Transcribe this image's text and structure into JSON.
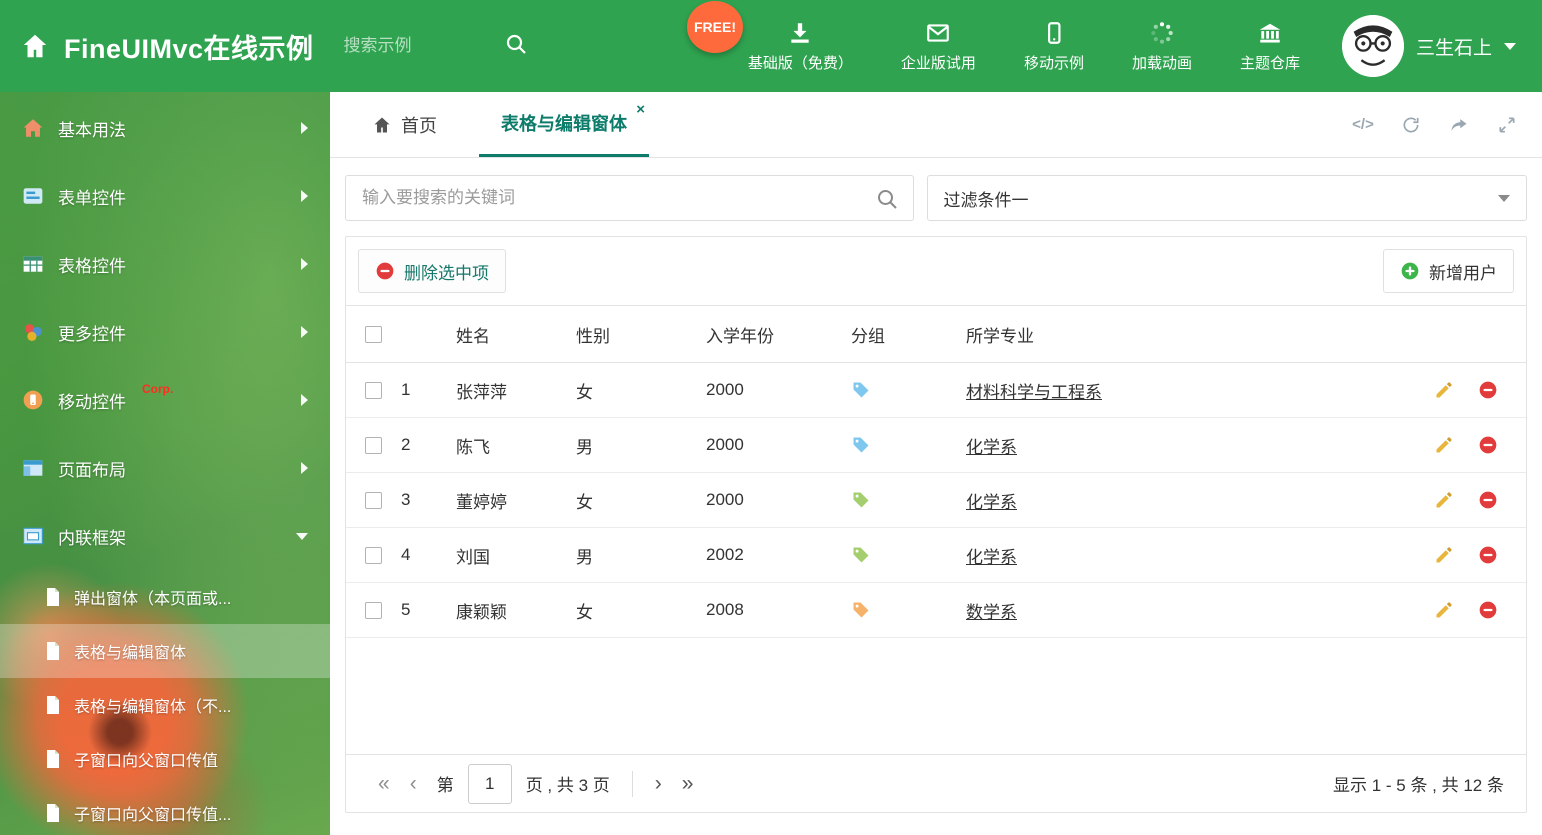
{
  "header": {
    "title": "FineUIMvc在线示例",
    "search_placeholder": "搜索示例",
    "free_badge": "FREE!",
    "nav": [
      {
        "label": "基础版（免费）"
      },
      {
        "label": "企业版试用"
      },
      {
        "label": "移动示例"
      },
      {
        "label": "加载动画"
      },
      {
        "label": "主题仓库"
      }
    ],
    "user_name": "三生石上"
  },
  "sidebar": {
    "items": [
      {
        "label": "基本用法"
      },
      {
        "label": "表单控件"
      },
      {
        "label": "表格控件"
      },
      {
        "label": "更多控件"
      },
      {
        "label": "移动控件",
        "badge": "Corp."
      },
      {
        "label": "页面布局"
      },
      {
        "label": "内联框架"
      }
    ],
    "submenu": [
      {
        "label": "弹出窗体（本页面或..."
      },
      {
        "label": "表格与编辑窗体"
      },
      {
        "label": "表格与编辑窗体（不..."
      },
      {
        "label": "子窗口向父窗口传值"
      },
      {
        "label": "子窗口向父窗口传值..."
      }
    ]
  },
  "tabs": {
    "home": "首页",
    "active": "表格与编辑窗体",
    "close_glyph": "×",
    "code_tool": "</>"
  },
  "filters": {
    "search_placeholder": "输入要搜索的关键词",
    "filter_value": "过滤条件一"
  },
  "grid": {
    "delete_button": "删除选中项",
    "add_button": "新增用户",
    "columns": [
      "姓名",
      "性别",
      "入学年份",
      "分组",
      "所学专业"
    ],
    "rows": [
      {
        "index": "1",
        "name": "张萍萍",
        "gender": "女",
        "year": "2000",
        "tag_color": "#7ec8ef",
        "major": "材料科学与工程系"
      },
      {
        "index": "2",
        "name": "陈飞",
        "gender": "男",
        "year": "2000",
        "tag_color": "#7ec8ef",
        "major": "化学系"
      },
      {
        "index": "3",
        "name": "董婷婷",
        "gender": "女",
        "year": "2000",
        "tag_color": "#a5cf6f",
        "major": "化学系"
      },
      {
        "index": "4",
        "name": "刘国",
        "gender": "男",
        "year": "2002",
        "tag_color": "#a5cf6f",
        "major": "化学系"
      },
      {
        "index": "5",
        "name": "康颖颖",
        "gender": "女",
        "year": "2008",
        "tag_color": "#f5b26b",
        "major": "数学系"
      }
    ]
  },
  "pagination": {
    "first": "«",
    "prev": "‹",
    "next": "›",
    "last": "»",
    "prefix": "第",
    "current": "1",
    "suffix": "页 , 共 3 页",
    "summary": "显示 1 - 5 条 , 共 12 条"
  },
  "colors": {
    "header_green": "#2fa350",
    "tab_teal": "#0e7c6b",
    "free_badge_orange": "#ff6a3c",
    "delete_red": "#e23b3b",
    "add_green": "#3cb54a",
    "tag_blue": "#7ec8ef",
    "tag_green": "#a5cf6f",
    "tag_orange": "#f5b26b"
  }
}
